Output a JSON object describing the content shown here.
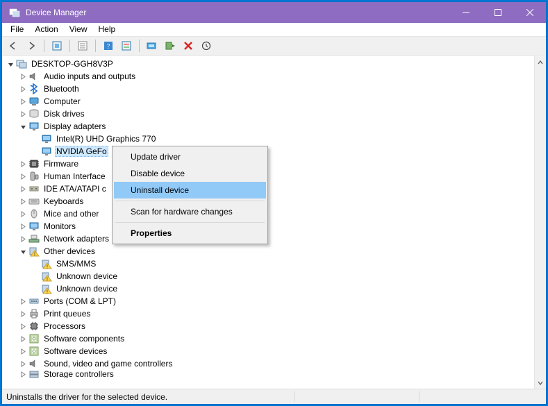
{
  "window": {
    "title": "Device Manager"
  },
  "menu": {
    "file": "File",
    "action": "Action",
    "view": "View",
    "help": "Help"
  },
  "toolbar": {
    "back": "back",
    "forward": "forward",
    "show_hidden": "show-hidden",
    "properties": "properties",
    "help": "help",
    "refresh": "refresh",
    "update": "update-driver",
    "uninstall": "uninstall",
    "disable": "disable",
    "scan": "scan-hardware"
  },
  "tree": {
    "root": "DESKTOP-GGH8V3P",
    "nodes": [
      {
        "label": "Audio inputs and outputs",
        "icon": "speaker",
        "expand": "closed"
      },
      {
        "label": "Bluetooth",
        "icon": "bluetooth",
        "expand": "closed"
      },
      {
        "label": "Computer",
        "icon": "computer",
        "expand": "closed"
      },
      {
        "label": "Disk drives",
        "icon": "disk",
        "expand": "closed"
      },
      {
        "label": "Display adapters",
        "icon": "monitor",
        "expand": "open",
        "children": [
          {
            "label": "Intel(R) UHD Graphics 770",
            "icon": "monitor"
          },
          {
            "label": "NVIDIA GeFo",
            "icon": "monitor",
            "selected": true,
            "truncated": true
          }
        ]
      },
      {
        "label": "Firmware",
        "icon": "firmware",
        "expand": "closed"
      },
      {
        "label": "Human Interface",
        "icon": "hid",
        "expand": "closed",
        "truncated": true
      },
      {
        "label": "IDE ATA/ATAPI c",
        "icon": "ide",
        "expand": "closed",
        "truncated": true
      },
      {
        "label": "Keyboards",
        "icon": "keyboard",
        "expand": "closed"
      },
      {
        "label": "Mice and other",
        "icon": "mouse",
        "expand": "closed",
        "truncated": true
      },
      {
        "label": "Monitors",
        "icon": "monitor",
        "expand": "closed"
      },
      {
        "label": "Network adapters",
        "icon": "network",
        "expand": "closed"
      },
      {
        "label": "Other devices",
        "icon": "warning",
        "expand": "open",
        "children": [
          {
            "label": "SMS/MMS",
            "icon": "warning"
          },
          {
            "label": "Unknown device",
            "icon": "warning"
          },
          {
            "label": "Unknown device",
            "icon": "warning"
          }
        ]
      },
      {
        "label": "Ports (COM & LPT)",
        "icon": "port",
        "expand": "closed"
      },
      {
        "label": "Print queues",
        "icon": "printer",
        "expand": "closed"
      },
      {
        "label": "Processors",
        "icon": "cpu",
        "expand": "closed"
      },
      {
        "label": "Software components",
        "icon": "software",
        "expand": "closed"
      },
      {
        "label": "Software devices",
        "icon": "software",
        "expand": "closed"
      },
      {
        "label": "Sound, video and game controllers",
        "icon": "speaker",
        "expand": "closed"
      },
      {
        "label": "Storage controllers",
        "icon": "storage",
        "expand": "closed",
        "cut": true
      }
    ]
  },
  "context_menu": {
    "items": [
      {
        "label": "Update driver",
        "type": "item"
      },
      {
        "label": "Disable device",
        "type": "item"
      },
      {
        "label": "Uninstall device",
        "type": "item",
        "highlight": true
      },
      {
        "type": "sep"
      },
      {
        "label": "Scan for hardware changes",
        "type": "item"
      },
      {
        "type": "sep"
      },
      {
        "label": "Properties",
        "type": "item",
        "bold": true
      }
    ]
  },
  "status": {
    "text": "Uninstalls the driver for the selected device."
  }
}
